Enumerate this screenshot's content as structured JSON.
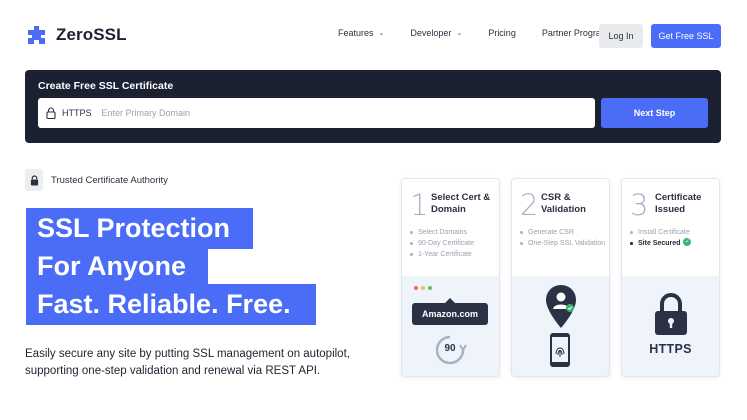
{
  "brand": {
    "name": "ZeroSSL",
    "accent": "#4a6cf7",
    "dark": "#1c2132"
  },
  "nav": {
    "features": "Features",
    "developer": "Developer",
    "pricing": "Pricing",
    "partner": "Partner Program",
    "login": "Log In",
    "get_free": "Get Free SSL"
  },
  "create": {
    "title": "Create Free SSL Certificate",
    "protocol": "HTTPS",
    "placeholder": "Enter Primary Domain",
    "value": "",
    "next": "Next Step"
  },
  "trusted": {
    "text": "Trusted Certificate Authority",
    "icon": "lock-icon"
  },
  "hero": {
    "line1": "SSL Protection",
    "line2": "For Anyone",
    "line3": "Fast. Reliable. Free.",
    "description": "Easily secure any site by putting SSL management on autopilot, supporting one-step validation and renewal via REST API."
  },
  "steps": [
    {
      "number": "1",
      "title": "Select Cert & Domain",
      "bullets": [
        "Select Domains",
        "90-Day Certificate",
        "1-Year Certificate"
      ],
      "art_label": "Amazon.com",
      "art_value": "90"
    },
    {
      "number": "2",
      "title": "CSR & Validation",
      "bullets": [
        "Generate CSR",
        "One-Step SSL Validation"
      ]
    },
    {
      "number": "3",
      "title": "Certificate Issued",
      "bullets": [
        "Install Certificate",
        "Site Secured"
      ],
      "art_label": "HTTPS"
    }
  ]
}
